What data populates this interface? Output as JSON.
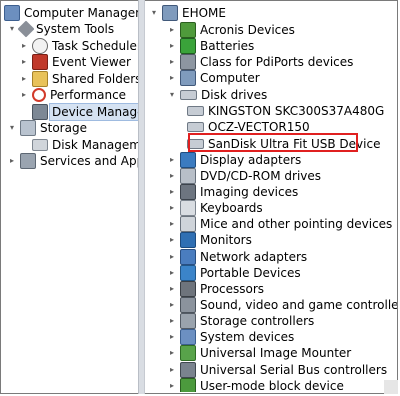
{
  "left_tree": [
    {
      "label": "Computer Management",
      "icon": "computer-management-icon",
      "expander": ""
    },
    {
      "label": "System Tools",
      "icon": "tools-icon",
      "expander": "▾"
    },
    {
      "label": "Task Scheduler",
      "icon": "clock-icon",
      "expander": "▸"
    },
    {
      "label": "Event Viewer",
      "icon": "event-log-icon",
      "expander": "▸"
    },
    {
      "label": "Shared Folders",
      "icon": "shared-folder-icon",
      "expander": "▸"
    },
    {
      "label": "Performance",
      "icon": "performance-icon",
      "expander": "▸"
    },
    {
      "label": "Device Manager",
      "icon": "device-manager-icon",
      "expander": "",
      "selected": true
    },
    {
      "label": "Storage",
      "icon": "storage-icon",
      "expander": "▾"
    },
    {
      "label": "Disk Management",
      "icon": "disk-icon",
      "expander": ""
    },
    {
      "label": "Services and Applicati",
      "icon": "services-icon",
      "expander": "▸"
    }
  ],
  "device_tree": {
    "root": "EHOME",
    "items": [
      {
        "label": "Acronis Devices",
        "icon": "generic-device-icon",
        "expander": "▸"
      },
      {
        "label": "Batteries",
        "icon": "battery-icon",
        "expander": "▸"
      },
      {
        "label": "Class for PdiPorts devices",
        "icon": "port-icon",
        "expander": "▸"
      },
      {
        "label": "Computer",
        "icon": "computer-icon",
        "expander": "▸"
      },
      {
        "label": "Disk drives",
        "icon": "disk-drive-icon",
        "expander": "▾"
      },
      {
        "label": "KINGSTON SKC300S37A480G",
        "icon": "disk-drive-icon",
        "expander": "",
        "child": true
      },
      {
        "label": "OCZ-VECTOR150",
        "icon": "disk-drive-icon",
        "expander": "",
        "child": true
      },
      {
        "label": "SanDisk Ultra Fit USB Device",
        "icon": "disk-drive-icon",
        "expander": "",
        "child": true,
        "highlighted": true
      },
      {
        "label": "Display adapters",
        "icon": "display-adapter-icon",
        "expander": "▸"
      },
      {
        "label": "DVD/CD-ROM drives",
        "icon": "dvd-icon",
        "expander": "▸"
      },
      {
        "label": "Imaging devices",
        "icon": "camera-icon",
        "expander": "▸"
      },
      {
        "label": "Keyboards",
        "icon": "keyboard-icon",
        "expander": "▸"
      },
      {
        "label": "Mice and other pointing devices",
        "icon": "mouse-icon",
        "expander": "▸"
      },
      {
        "label": "Monitors",
        "icon": "monitor-icon",
        "expander": "▸"
      },
      {
        "label": "Network adapters",
        "icon": "network-adapter-icon",
        "expander": "▸"
      },
      {
        "label": "Portable Devices",
        "icon": "portable-device-icon",
        "expander": "▸"
      },
      {
        "label": "Processors",
        "icon": "processor-icon",
        "expander": "▸"
      },
      {
        "label": "Sound, video and game controllers",
        "icon": "sound-icon",
        "expander": "▸"
      },
      {
        "label": "Storage controllers",
        "icon": "storage-controller-icon",
        "expander": "▸"
      },
      {
        "label": "System devices",
        "icon": "system-device-icon",
        "expander": "▸"
      },
      {
        "label": "Universal Image Mounter",
        "icon": "image-mounter-icon",
        "expander": "▸"
      },
      {
        "label": "Universal Serial Bus controllers",
        "icon": "usb-icon",
        "expander": "▸"
      },
      {
        "label": "User-mode block device",
        "icon": "block-device-icon",
        "expander": "▸"
      }
    ]
  },
  "colors": {
    "selection_bg": "#d5e2f2",
    "highlight_border": "#e02020",
    "splitter": "#d9dde3"
  }
}
